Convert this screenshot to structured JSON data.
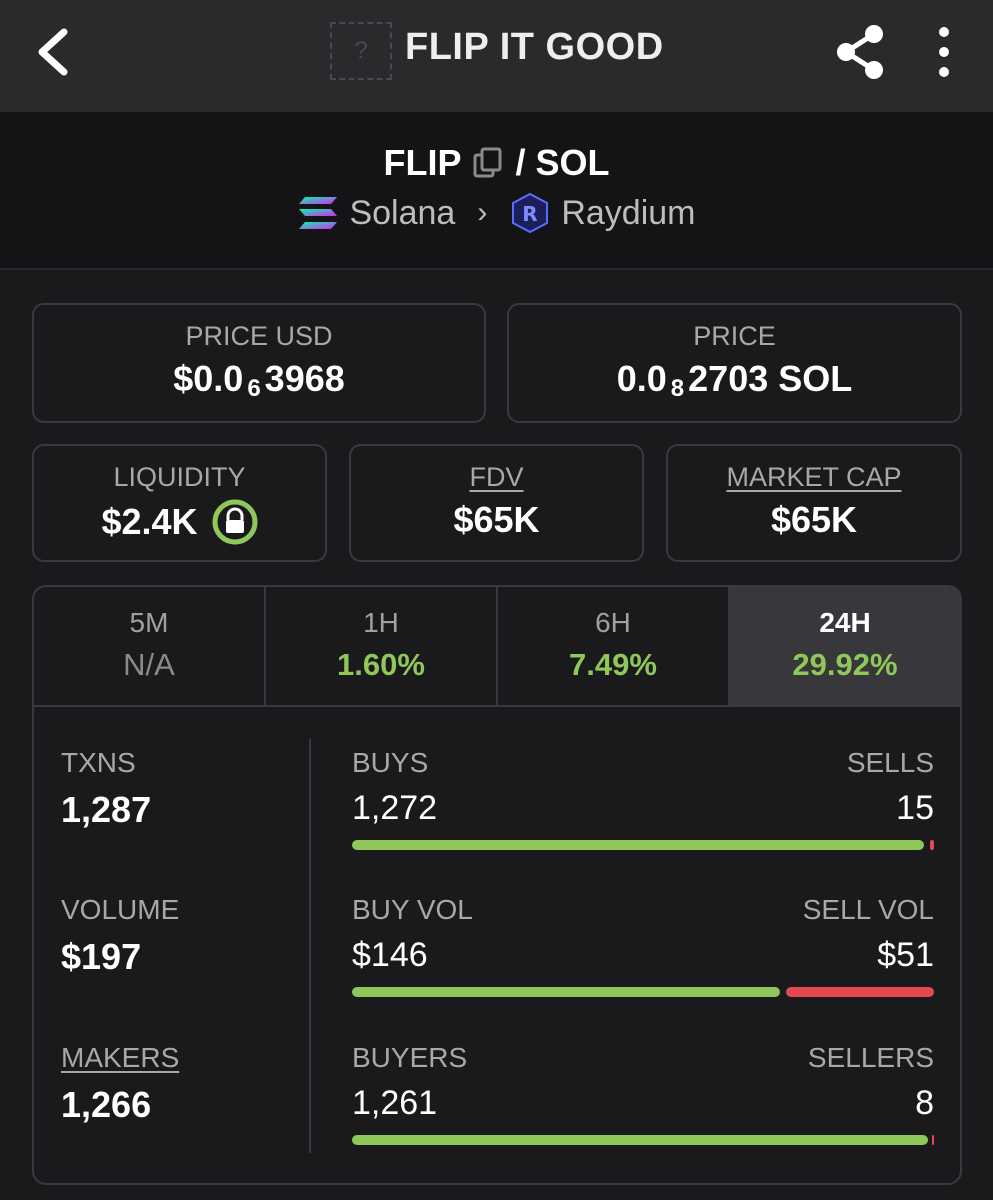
{
  "header": {
    "title": "FLIP IT GOOD",
    "token_logo_placeholder": "?"
  },
  "pair": {
    "base": "FLIP",
    "separator": "/",
    "quote": "SOL",
    "chain": "Solana",
    "dex": "Raydium"
  },
  "price_usd": {
    "label": "PRICE USD",
    "prefix": "$0.0",
    "zeros": "6",
    "digits": "3968"
  },
  "price_sol": {
    "label": "PRICE",
    "prefix": "0.0",
    "zeros": "8",
    "digits": "2703 SOL"
  },
  "liquidity": {
    "label": "LIQUIDITY",
    "value": "$2.4K"
  },
  "fdv": {
    "label": "FDV",
    "value": "$65K"
  },
  "market_cap": {
    "label": "MARKET CAP",
    "value": "$65K"
  },
  "tabs": [
    {
      "label": "5M",
      "change": "N/A"
    },
    {
      "label": "1H",
      "change": "1.60%"
    },
    {
      "label": "6H",
      "change": "7.49%"
    },
    {
      "label": "24H",
      "change": "29.92%",
      "active": true
    }
  ],
  "metrics": {
    "txns": {
      "label": "TXNS",
      "value": "1,287"
    },
    "volume": {
      "label": "VOLUME",
      "value": "$197"
    },
    "makers": {
      "label": "MAKERS",
      "value": "1,266"
    }
  },
  "splits": {
    "trades": {
      "left_label": "BUYS",
      "right_label": "SELLS",
      "left_value": "1,272",
      "right_value": "15",
      "buy_fraction": 0.988
    },
    "volume": {
      "left_label": "BUY VOL",
      "right_label": "SELL VOL",
      "left_value": "$146",
      "right_value": "$51",
      "buy_fraction": 0.741
    },
    "wallets": {
      "left_label": "BUYERS",
      "right_label": "SELLERS",
      "left_value": "1,261",
      "right_value": "8",
      "buy_fraction": 0.994
    }
  },
  "colors": {
    "positive": "#8fc858",
    "negative": "#e5484d",
    "background": "#1a1a1d",
    "liquidity_lock": "#8fc858"
  }
}
